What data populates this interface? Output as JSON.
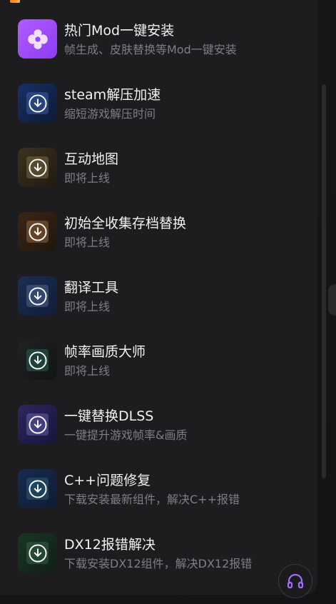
{
  "accent": "#a46bff",
  "items": [
    {
      "title": "热门Mod一键安装",
      "subtitle": "帧生成、皮肤替换等Mod一键安装",
      "icon": "mod-icon",
      "tile_color": "#a24dff"
    },
    {
      "title": "steam解压加速",
      "subtitle": "缩短游戏解压时间",
      "icon": "download-icon",
      "tile_color": "#112040"
    },
    {
      "title": "互动地图",
      "subtitle": "即将上线",
      "icon": "download-icon",
      "tile_color": "#2b2418"
    },
    {
      "title": "初始全收集存档替换",
      "subtitle": "即将上线",
      "icon": "download-icon",
      "tile_color": "#2a1e14"
    },
    {
      "title": "翻译工具",
      "subtitle": "即将上线",
      "icon": "download-icon",
      "tile_color": "#15233f"
    },
    {
      "title": "帧率画质大师",
      "subtitle": "即将上线",
      "icon": "download-icon",
      "tile_color": "#161818"
    },
    {
      "title": "一键替换DLSS",
      "subtitle": "一键提升游戏帧率&画质",
      "icon": "download-icon",
      "tile_color": "#1d1a3c"
    },
    {
      "title": "C++问题修复",
      "subtitle": "下载安装最新组件，解决C++报错",
      "icon": "download-icon",
      "tile_color": "#13203a"
    },
    {
      "title": "DX12报错解决",
      "subtitle": "下载安装DX12组件，解决DX12报错",
      "icon": "download-icon",
      "tile_color": "#17271f"
    }
  ],
  "support_button": {
    "icon": "headphones-icon",
    "color": "#a46bff"
  }
}
